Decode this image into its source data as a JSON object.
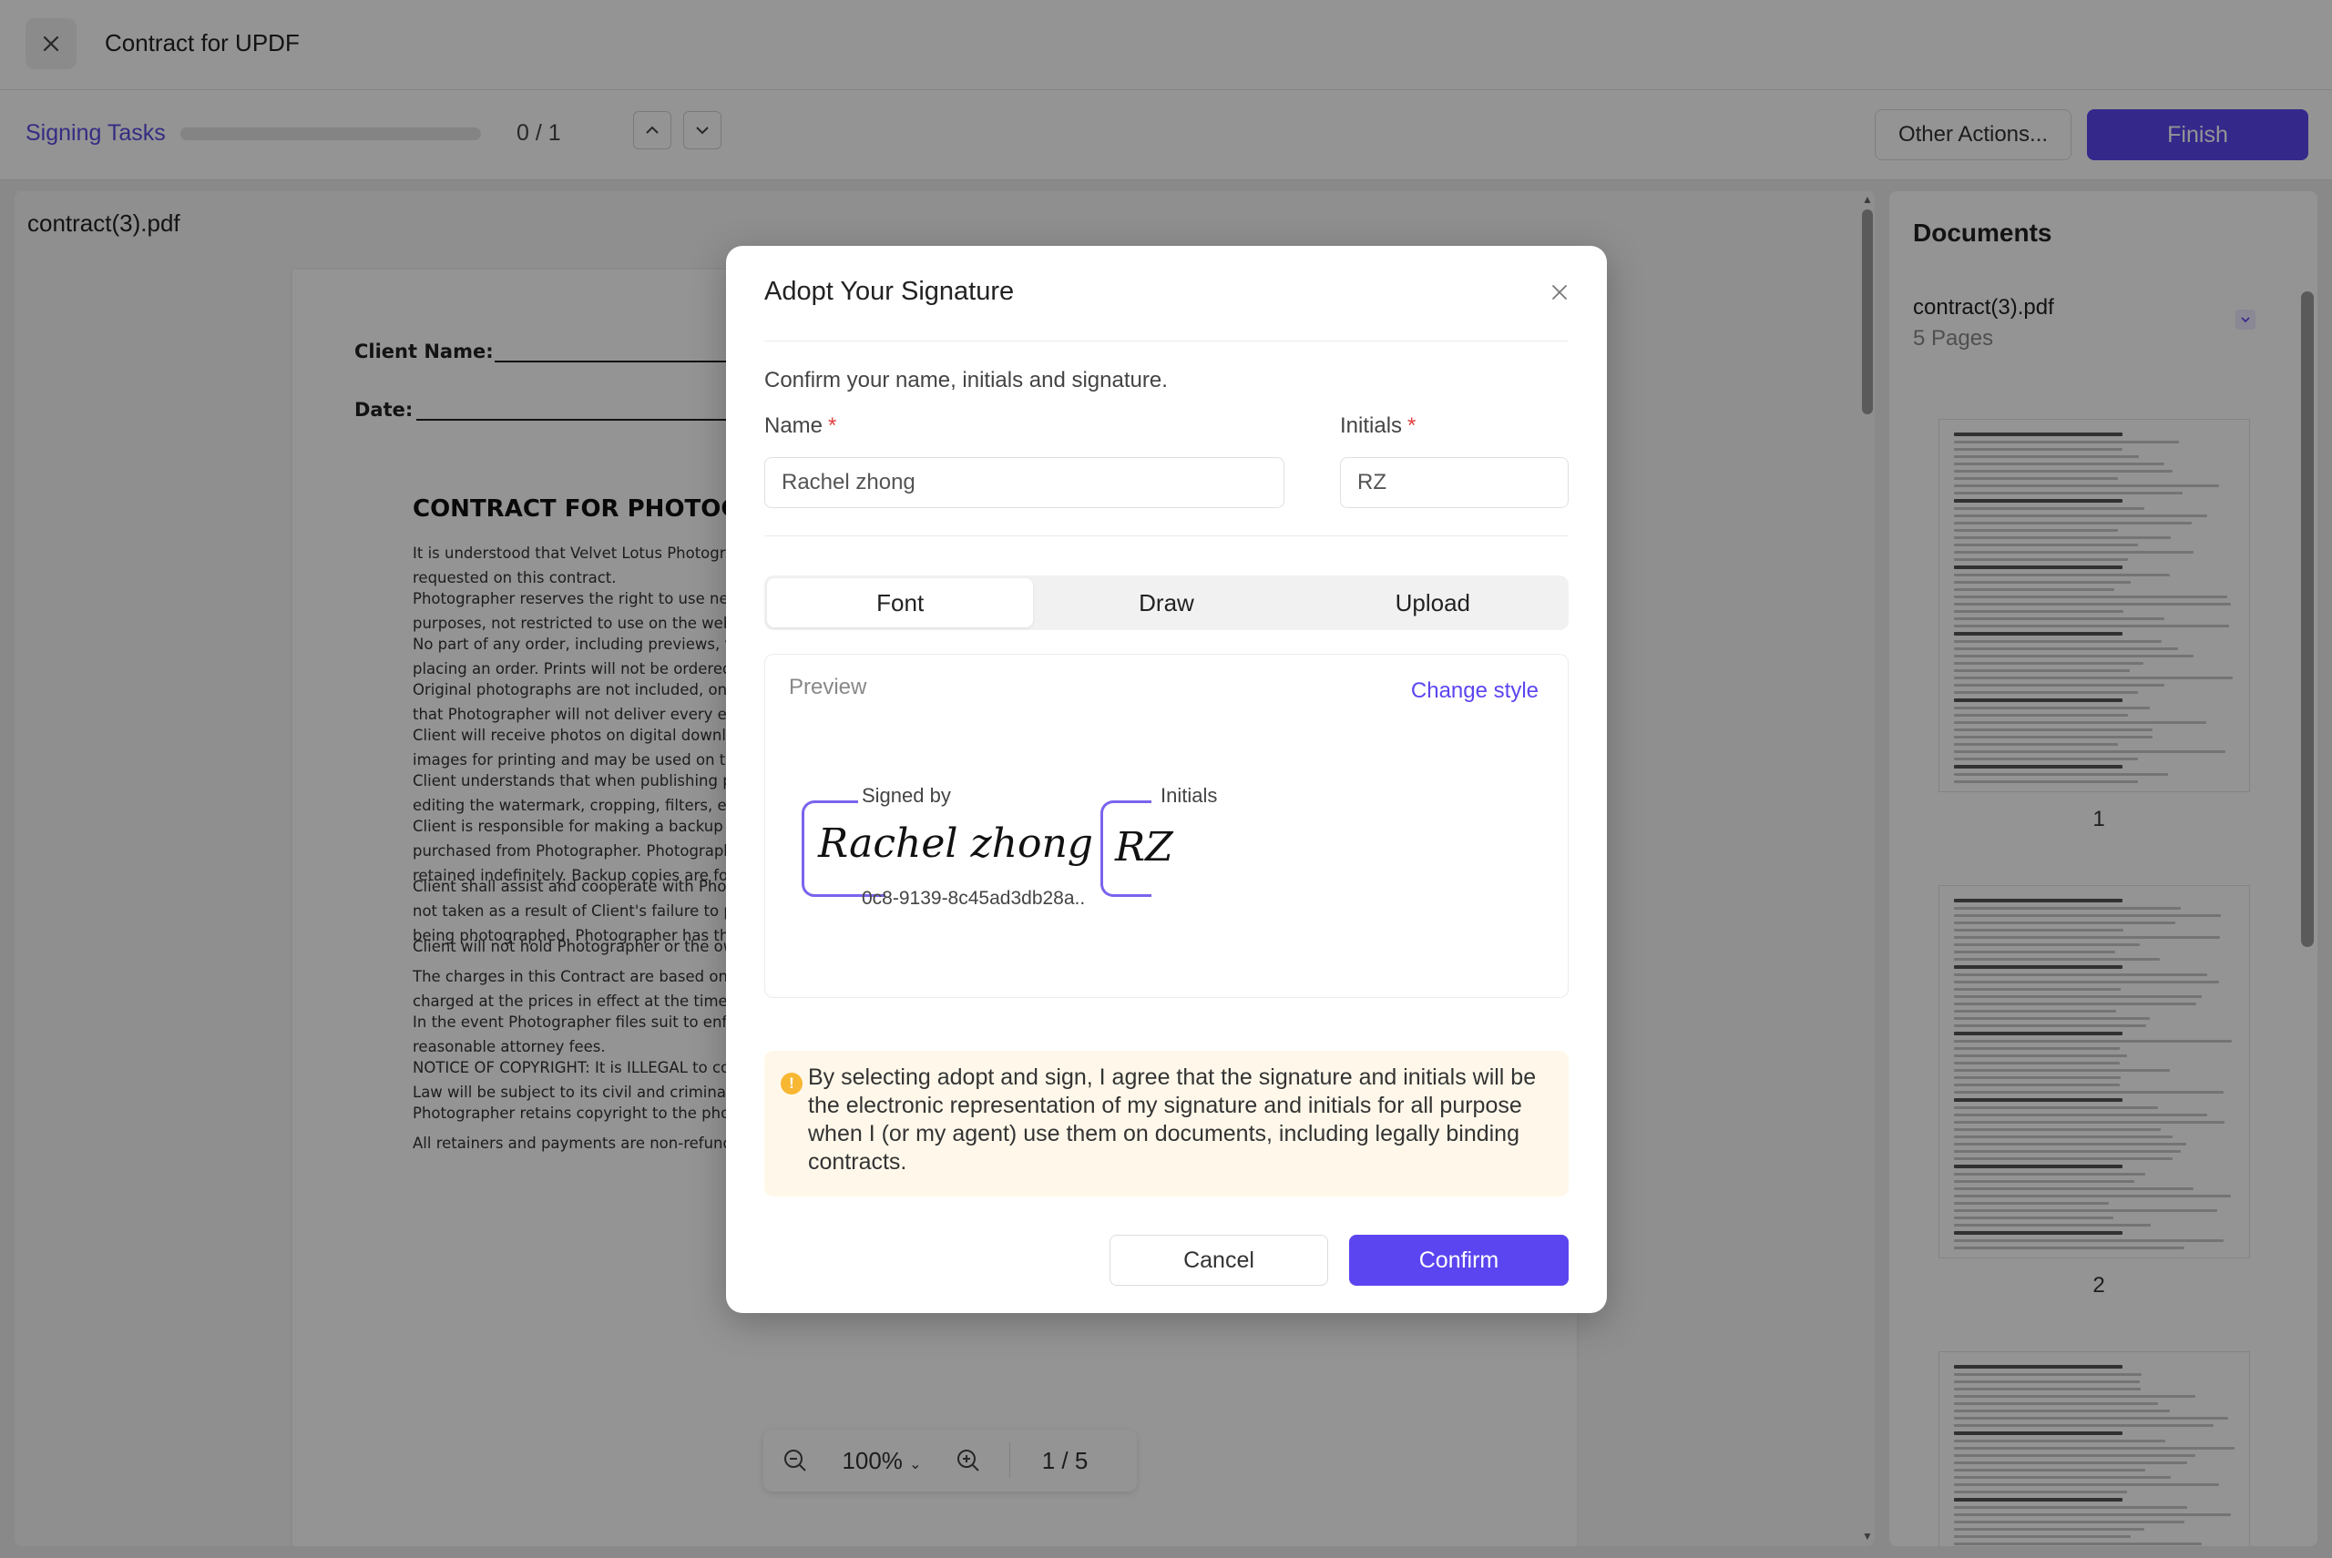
{
  "window": {
    "title": "Contract for UPDF"
  },
  "taskbar": {
    "signing_tasks": "Signing Tasks",
    "progress": 0,
    "count": "0 / 1",
    "other_actions": "Other Actions...",
    "finish": "Finish"
  },
  "document": {
    "file_name": "contract(3).pdf",
    "fields": {
      "client_name": "Client Name:",
      "date": "Date:"
    },
    "heading": "CONTRACT FOR PHOTOG",
    "paragraphs": [
      [
        "It is understood that Velvet Lotus Photogra",
        "requested on this contract."
      ],
      [
        "Photographer reserves the right to use nega",
        "purposes, not restricted to use on the web, l"
      ],
      [
        "No part of any order, including previews, v",
        "placing an order. Prints will not be ordered"
      ],
      [
        "Original photographs are not included, onl",
        "that Photographer will not deliver every exp"
      ],
      [
        "Client will receive photos on digital downl",
        "images for printing and may be used on the"
      ],
      [
        "Client understands that when publishing ph",
        "editing the watermark, cropping, filters, etc."
      ],
      [
        "Client is responsible for making a backup",
        "purchased from Photographer. Photograph",
        "retained indefinitely. Backup copies are for c"
      ],
      [
        "Client shall assist and cooperate with Phot",
        "not taken as a result of Client's failure to pr",
        "being photographed. Photographer has the"
      ],
      [
        "Client will not hold Photographer or the ow"
      ],
      [
        "The charges in this Contract are based on",
        "charged at the prices in effect at the time th"
      ],
      [
        "In the event Photographer files suit to enforce any term or condition herein, Photographer is entitled to expenses of litigation, including",
        "reasonable attorney fees."
      ],
      [
        "NOTICE OF COPYRIGHT: It is ILLEGAL to copy or reproduce these photographs without Photographer's permission, and violators of this Federal",
        "Law will be subject to its civil and criminal penalties."
      ],
      [
        "Photographer retains copyright to the photograp                              oted below."
      ],
      [
        "All retainers and payments are non-refundable."
      ]
    ],
    "zoom": "100%",
    "page_indicator": "1 / 5"
  },
  "documents_panel": {
    "title": "Documents",
    "file": "contract(3).pdf",
    "pages": "5 Pages",
    "thumbnails": [
      "1",
      "2"
    ]
  },
  "modal": {
    "title": "Adopt Your Signature",
    "description": "Confirm your name, initials and signature.",
    "name_label": "Name",
    "name_value": "Rachel zhong",
    "initials_label": "Initials",
    "initials_value": "RZ",
    "required_mark": "*",
    "tabs": [
      "Font",
      "Draw",
      "Upload"
    ],
    "active_tab": "Font",
    "preview_label": "Preview",
    "change_style": "Change style",
    "signed_by_label": "Signed by",
    "signature_text": "Rachel zhong",
    "signature_hash": "0c8-9139-8c45ad3db28a..",
    "initials_caption": "Initials",
    "initials_signature": "RZ",
    "notice": "By selecting adopt and sign, I agree that the signature and initials will be the electronic representation of my signature and initials for all purpose when I (or my agent) use them on documents, including legally binding contracts.",
    "notice_icon": "!",
    "cancel": "Cancel",
    "confirm": "Confirm"
  },
  "icons": {
    "close": "close-icon",
    "up": "chevron-up-icon",
    "down": "chevron-down-icon",
    "zoom_out": "zoom-out-icon",
    "zoom_in": "zoom-in-icon",
    "info": "info-icon"
  },
  "colors": {
    "accent": "#5b45f0",
    "notice_bg": "#fff8ea",
    "signature_frame": "#7b63ee"
  }
}
